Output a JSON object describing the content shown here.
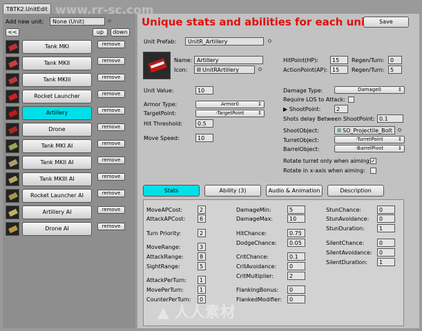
{
  "window": {
    "title": "TBTK2.UnitEdit"
  },
  "headline": "Unique stats and abilities for each unit",
  "top": {
    "add_label": "Add new unit:",
    "add_value": "None (Unit)",
    "back": "<<",
    "up": "up",
    "down": "down",
    "save": "Save"
  },
  "units": [
    {
      "name": "Tank MKI",
      "remove": "remove"
    },
    {
      "name": "Tank MKII",
      "remove": "remove"
    },
    {
      "name": "Tank MKIII",
      "remove": "remove"
    },
    {
      "name": "Rocket Launcher",
      "remove": "remove"
    },
    {
      "name": "Artillery",
      "remove": "remove"
    },
    {
      "name": "Drone",
      "remove": "remove"
    },
    {
      "name": "Tank MKI AI",
      "remove": "remove"
    },
    {
      "name": "Tank MKII AI",
      "remove": "remove"
    },
    {
      "name": "Tank MKIII AI",
      "remove": "remove"
    },
    {
      "name": "Rocket Launcher AI",
      "remove": "remove"
    },
    {
      "name": "Artillery AI",
      "remove": "remove"
    },
    {
      "name": "Drone AI",
      "remove": "remove"
    }
  ],
  "detail": {
    "prefab_label": "Unit Prefab:",
    "prefab_value": "UnitR_Artillery",
    "name_label": "Name:",
    "name_value": "Artillery",
    "icon_label": "Icon:",
    "icon_value": "UnitRArtillery",
    "hp_label": "HitPoint(HP):",
    "hp_value": "15",
    "hp_regen_label": "Regen/Turn:",
    "hp_regen_value": "0",
    "ap_label": "ActionPoint(AP):",
    "ap_value": "15",
    "ap_regen_label": "Regen/Turn:",
    "ap_regen_value": "5",
    "unit_value_label": "Unit Value:",
    "unit_value": "10",
    "armor_label": "Armor Type:",
    "armor_value": "Armor0",
    "target_label": "TargetPoint:",
    "target_value": "-TargetPoint",
    "hitthr_label": "Hit Threshold:",
    "hitthr_value": "0.5",
    "move_label": "Move Speed:",
    "move_value": "10",
    "damage_label": "Damage Type:",
    "damage_value": "Damage0",
    "los_label": "Require LOS to Attack:",
    "shootpoint_label": "ShootPoint:",
    "shootpoint_value": "2",
    "shots_label": "Shots delay Between ShootPoint:",
    "shots_value": "0.1",
    "shootobj_label": "ShootObject:",
    "shootobj_value": "SO_Projectile_Bolt",
    "turret_label": "TurretObject:",
    "turret_value": "-TurretPoint",
    "barrel_label": "BarrelObject:",
    "barrel_value": "-BarrelPivot",
    "rot_aim_label": "Rotate turret only when aiming:",
    "rot_x_label": "Rotate in x-axis when aiming:"
  },
  "tabs": [
    "Stats",
    "Ability (3)",
    "Audio & Animation",
    "Description"
  ],
  "stats": {
    "col1": [
      {
        "label": "MoveAPCost:",
        "value": "2"
      },
      {
        "label": "AttackAPCost:",
        "value": "6"
      },
      {
        "label": "Turn Priority:",
        "value": "2"
      },
      {
        "label": "MoveRange:",
        "value": "3"
      },
      {
        "label": "AttackRange:",
        "value": "8"
      },
      {
        "label": "SightRange:",
        "value": "5"
      },
      {
        "label": "AttackPerTurn:",
        "value": "1"
      },
      {
        "label": "MovePerTurn:",
        "value": "1"
      },
      {
        "label": "CounterPerTurn:",
        "value": "0"
      }
    ],
    "col2": [
      {
        "label": "DamageMin:",
        "value": "5"
      },
      {
        "label": "DamageMax:",
        "value": "10"
      },
      {
        "label": "HitChance:",
        "value": "0.75"
      },
      {
        "label": "DodgeChance:",
        "value": "0.05"
      },
      {
        "label": "CritChance:",
        "value": "0.1"
      },
      {
        "label": "CritAvoidance:",
        "value": "0"
      },
      {
        "label": "CritMultiplier:",
        "value": "2"
      },
      {
        "label": "FlankingBonus:",
        "value": "0"
      },
      {
        "label": "FlankedModifier:",
        "value": "0"
      }
    ],
    "col3": [
      {
        "label": "StunChance:",
        "value": "0"
      },
      {
        "label": "StunAvoidance:",
        "value": "0"
      },
      {
        "label": "StunDuration:",
        "value": "1"
      },
      {
        "label": "SilentChance:",
        "value": "0"
      },
      {
        "label": "SilentAvoidance:",
        "value": "0"
      },
      {
        "label": "SilentDuration:",
        "value": "1"
      }
    ]
  }
}
